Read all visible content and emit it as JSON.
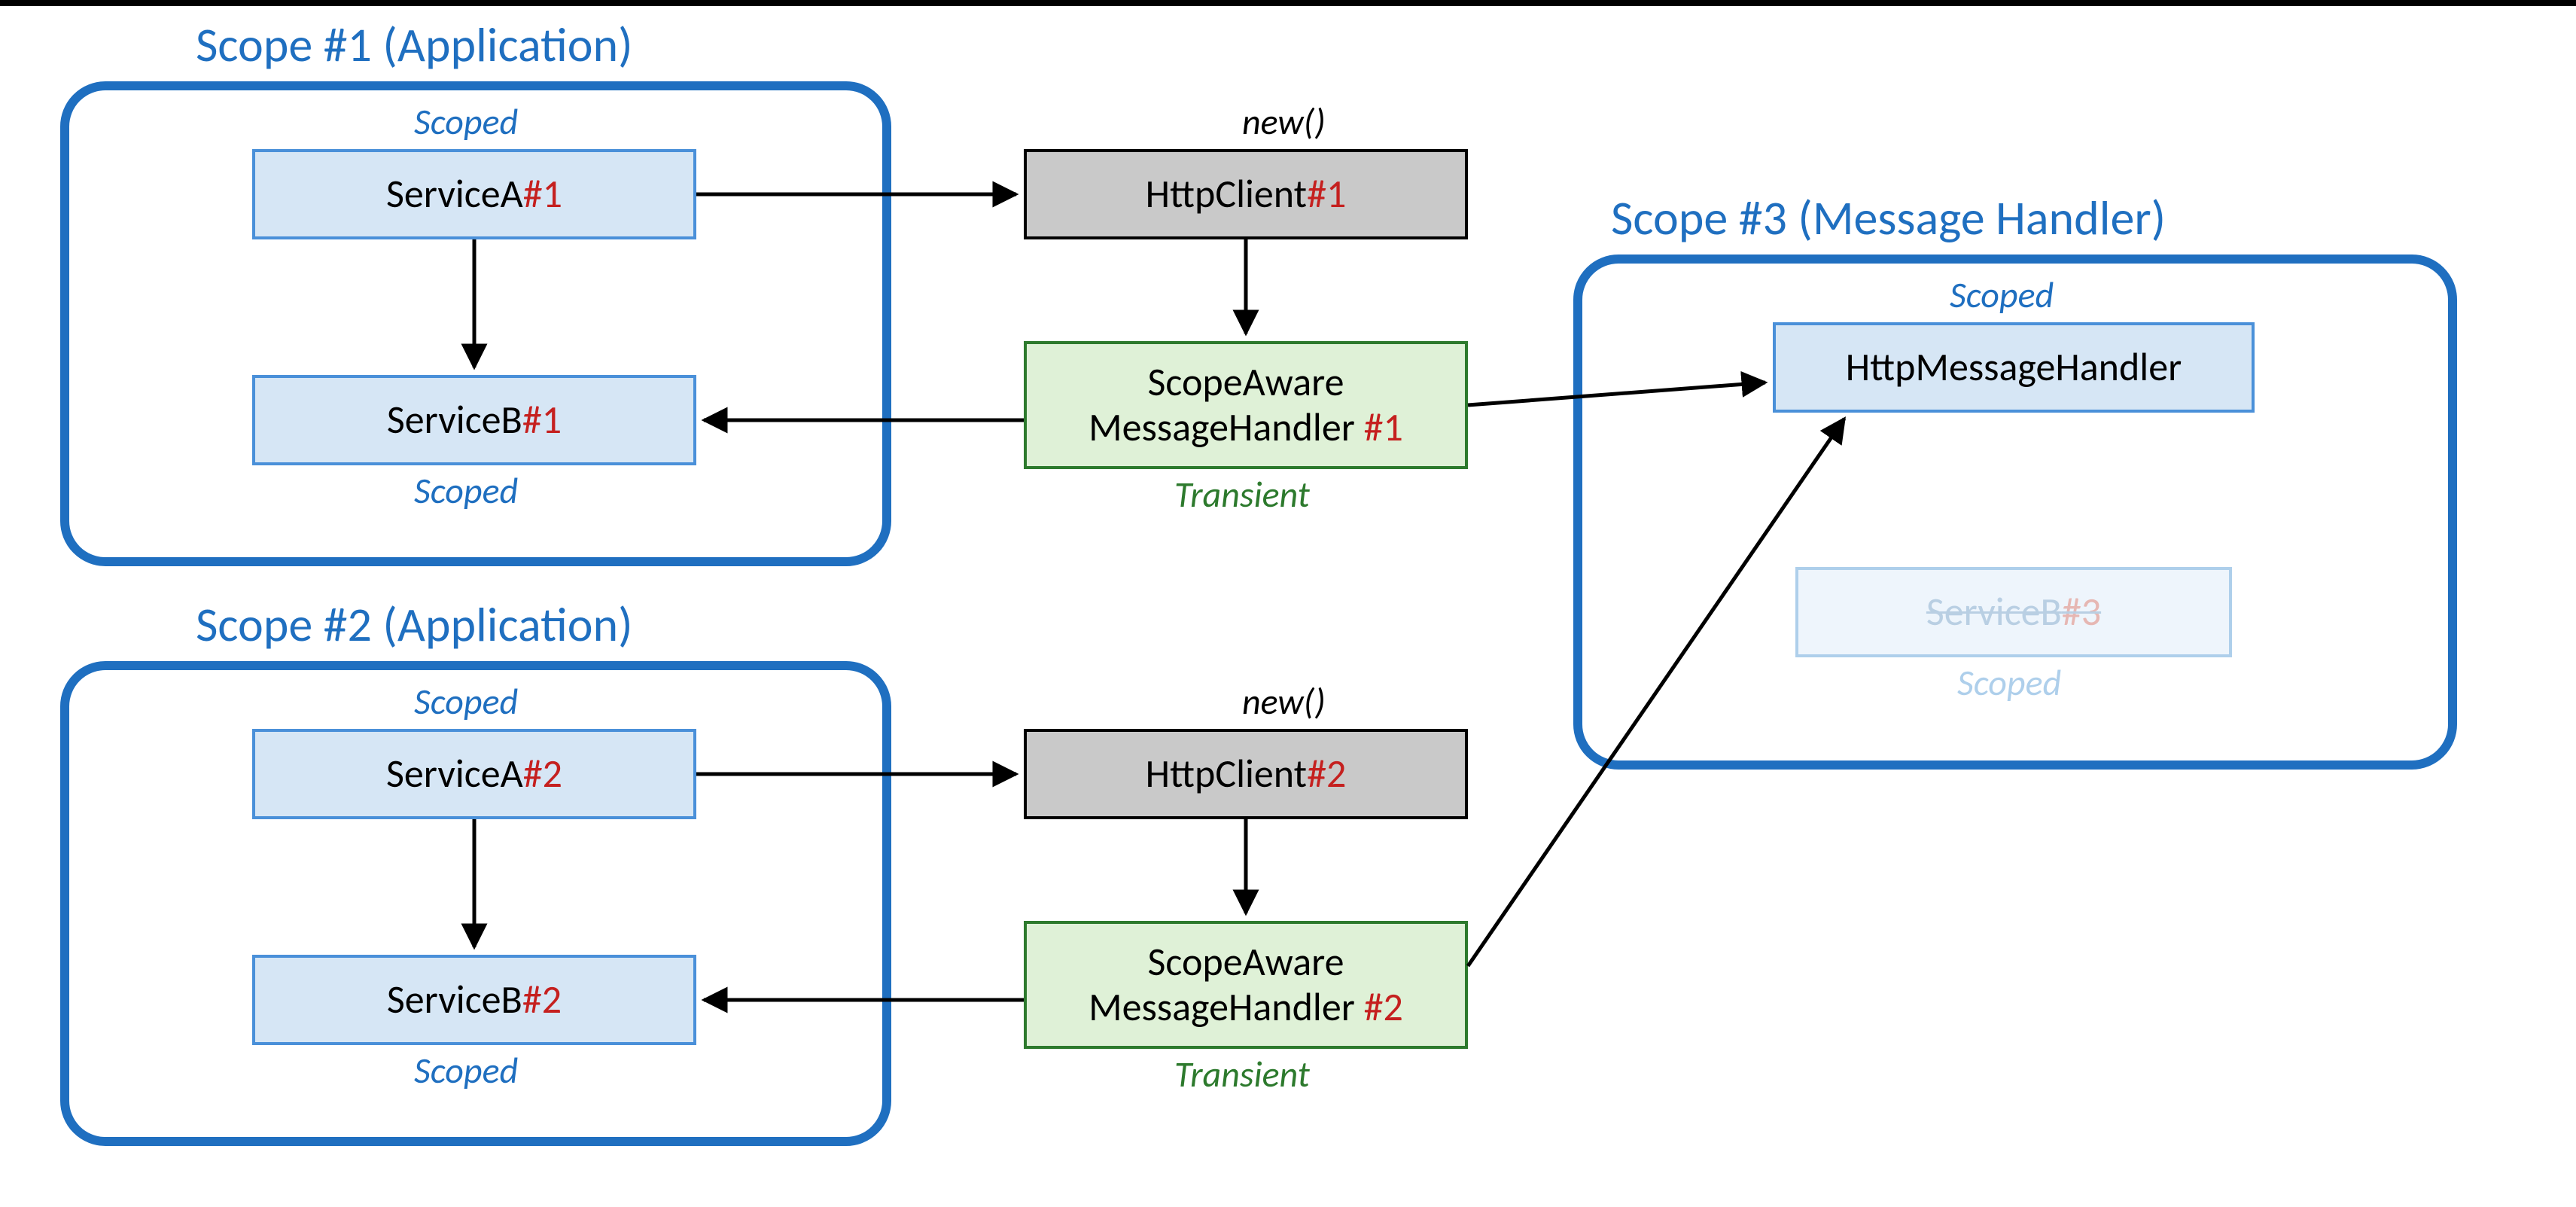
{
  "diagram": {
    "scopes": {
      "s1": {
        "title": "Scope #1 (Application)",
        "serviceA": {
          "name": "ServiceA",
          "inst": " #1",
          "lifetime": "Scoped"
        },
        "serviceB": {
          "name": "ServiceB",
          "inst": " #1",
          "lifetime": "Scoped"
        }
      },
      "s2": {
        "title": "Scope #2 (Application)",
        "serviceA": {
          "name": "ServiceA",
          "inst": " #2",
          "lifetime": "Scoped"
        },
        "serviceB": {
          "name": "ServiceB",
          "inst": " #2",
          "lifetime": "Scoped"
        }
      },
      "s3": {
        "title": "Scope #3 (Message Handler)",
        "handler": {
          "name": "HttpMessageHandler",
          "lifetime": "Scoped"
        },
        "serviceB": {
          "name": "ServiceB",
          "inst": " #3",
          "lifetime": "Scoped",
          "faded": true
        }
      }
    },
    "httpClients": {
      "c1": {
        "name": "HttpClient",
        "inst": " #1",
        "creation": "new()"
      },
      "c2": {
        "name": "HttpClient",
        "inst": " #2",
        "creation": "new()"
      }
    },
    "scopeAware": {
      "m1": {
        "line1": "ScopeAware",
        "line2": "MessageHandler",
        "inst": " #1",
        "lifetime": "Transient"
      },
      "m2": {
        "line1": "ScopeAware",
        "line2": "MessageHandler",
        "inst": " #2",
        "lifetime": "Transient"
      }
    }
  },
  "chart_data": {
    "type": "diagram",
    "nodes": [
      {
        "id": "s1.serviceA",
        "label": "ServiceA #1",
        "scope": "Scope #1 (Application)",
        "lifetime": "Scoped",
        "style": "blue"
      },
      {
        "id": "s1.serviceB",
        "label": "ServiceB #1",
        "scope": "Scope #1 (Application)",
        "lifetime": "Scoped",
        "style": "blue"
      },
      {
        "id": "httpClient1",
        "label": "HttpClient #1",
        "scope": null,
        "creation": "new()",
        "style": "gray"
      },
      {
        "id": "scopeAware1",
        "label": "ScopeAware MessageHandler #1",
        "scope": null,
        "lifetime": "Transient",
        "style": "green"
      },
      {
        "id": "s2.serviceA",
        "label": "ServiceA #2",
        "scope": "Scope #2 (Application)",
        "lifetime": "Scoped",
        "style": "blue"
      },
      {
        "id": "s2.serviceB",
        "label": "ServiceB #2",
        "scope": "Scope #2 (Application)",
        "lifetime": "Scoped",
        "style": "blue"
      },
      {
        "id": "httpClient2",
        "label": "HttpClient #2",
        "scope": null,
        "creation": "new()",
        "style": "gray"
      },
      {
        "id": "scopeAware2",
        "label": "ScopeAware MessageHandler #2",
        "scope": null,
        "lifetime": "Transient",
        "style": "green"
      },
      {
        "id": "s3.handler",
        "label": "HttpMessageHandler",
        "scope": "Scope #3 (Message Handler)",
        "lifetime": "Scoped",
        "style": "blue"
      },
      {
        "id": "s3.serviceB",
        "label": "ServiceB #3",
        "scope": "Scope #3 (Message Handler)",
        "lifetime": "Scoped",
        "style": "blue",
        "faded": true,
        "strikethrough": true
      }
    ],
    "edges": [
      {
        "from": "s1.serviceA",
        "to": "httpClient1"
      },
      {
        "from": "s1.serviceA",
        "to": "s1.serviceB"
      },
      {
        "from": "httpClient1",
        "to": "scopeAware1"
      },
      {
        "from": "scopeAware1",
        "to": "s1.serviceB"
      },
      {
        "from": "scopeAware1",
        "to": "s3.handler"
      },
      {
        "from": "s2.serviceA",
        "to": "httpClient2"
      },
      {
        "from": "s2.serviceA",
        "to": "s2.serviceB"
      },
      {
        "from": "httpClient2",
        "to": "scopeAware2"
      },
      {
        "from": "scopeAware2",
        "to": "s2.serviceB"
      },
      {
        "from": "scopeAware2",
        "to": "s3.handler"
      }
    ],
    "scopes": [
      {
        "id": "scope1",
        "title": "Scope #1 (Application)",
        "contains": [
          "s1.serviceA",
          "s1.serviceB"
        ]
      },
      {
        "id": "scope2",
        "title": "Scope #2 (Application)",
        "contains": [
          "s2.serviceA",
          "s2.serviceB"
        ]
      },
      {
        "id": "scope3",
        "title": "Scope #3 (Message Handler)",
        "contains": [
          "s3.handler",
          "s3.serviceB"
        ]
      }
    ]
  }
}
